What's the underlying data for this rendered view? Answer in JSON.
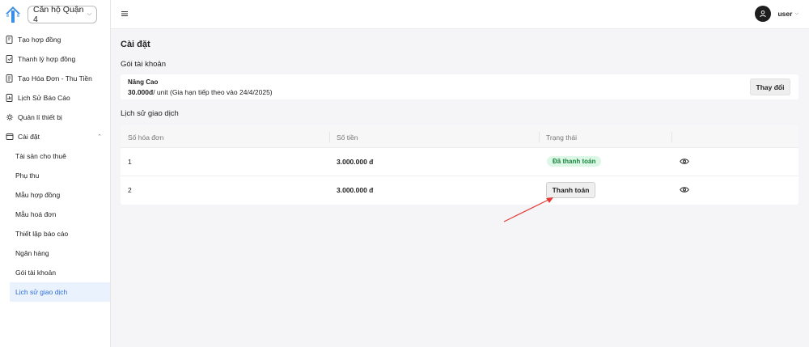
{
  "sidebar": {
    "property_selector": "Căn hộ Quận 4",
    "items": [
      {
        "label": "Tạo hợp đồng",
        "icon": "contract-add-icon"
      },
      {
        "label": "Thanh lý hợp đồng",
        "icon": "contract-end-icon"
      },
      {
        "label": "Tạo Hóa Đơn - Thu Tiền",
        "icon": "invoice-icon"
      },
      {
        "label": "Lịch Sử Báo Cáo",
        "icon": "report-history-icon"
      },
      {
        "label": "Quản lí thiết bị",
        "icon": "device-icon"
      },
      {
        "label": "Cài đặt",
        "icon": "gear-icon"
      }
    ],
    "settings_sub": [
      {
        "label": "Tài sản cho thuê"
      },
      {
        "label": "Phụ thu"
      },
      {
        "label": "Mẫu hợp đồng"
      },
      {
        "label": "Mẫu hoá đơn"
      },
      {
        "label": "Thiết lập báo cáo"
      },
      {
        "label": "Ngân hàng"
      },
      {
        "label": "Gói tài khoản"
      },
      {
        "label": "Lịch sử giao dịch"
      }
    ]
  },
  "header": {
    "username": "user"
  },
  "page": {
    "title": "Cài đặt",
    "plan_section_title": "Gói tài khoản",
    "plan": {
      "name": "Nâng Cao",
      "price": "30.000đ",
      "price_suffix": "/ unit (Gia hạn tiếp theo vào 24/4/2025)",
      "change_label": "Thay đổi"
    },
    "history_title": "Lịch sử giao dịch",
    "table": {
      "headers": [
        "Số hóa đơn",
        "Số tiền",
        "Trạng thái"
      ],
      "rows": [
        {
          "invoice": "1",
          "amount": "3.000.000 đ",
          "status": "Đã thanh toán"
        },
        {
          "invoice": "2",
          "amount": "3.000.000 đ",
          "action": "Thanh toán"
        }
      ]
    }
  },
  "colors": {
    "accent": "#2f6fd8",
    "paid_badge_bg": "#dcf7e6",
    "paid_badge_text": "#19833e",
    "annotation_arrow": "#e53935"
  }
}
